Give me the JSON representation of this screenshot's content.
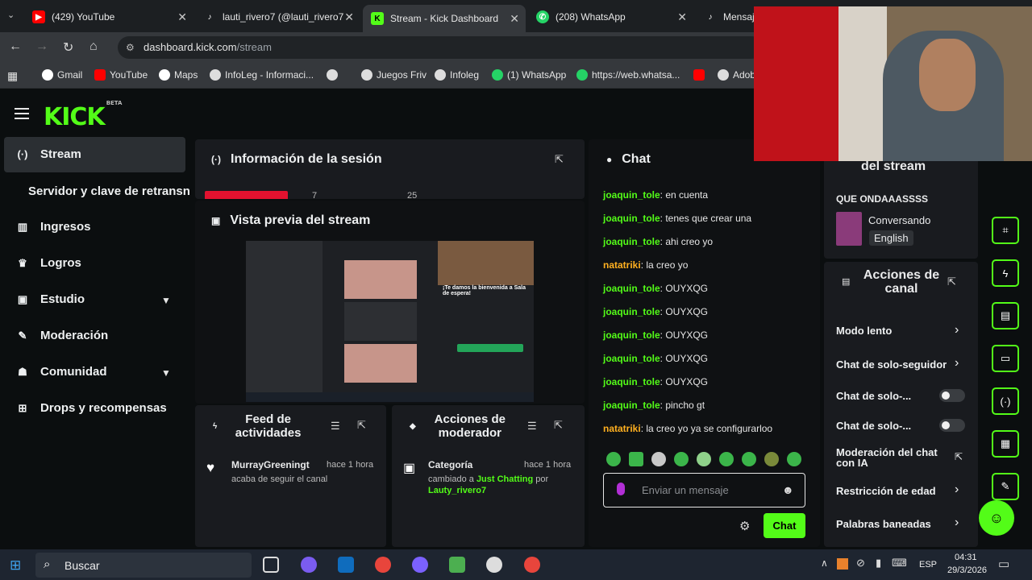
{
  "tabs": [
    {
      "label": "(429) YouTube",
      "icon": "youtube-icon",
      "color": "#ff0000"
    },
    {
      "label": "lauti_rivero7 (@lauti_rivero7",
      "icon": "tiktok-icon",
      "color": "#ffffff"
    },
    {
      "label": "Stream - Kick Dashboard",
      "icon": "kick-icon",
      "color": "#53fc18"
    },
    {
      "label": "(208) WhatsApp",
      "icon": "whatsapp-icon",
      "color": "#25d366"
    },
    {
      "label": "Mensaje",
      "icon": "tiktok-icon",
      "color": "#ffffff"
    }
  ],
  "address": {
    "host": "dashboard.kick.com",
    "path": "/stream"
  },
  "bookmarks": [
    {
      "label": "Gmail",
      "icon": "google-icon"
    },
    {
      "label": "YouTube",
      "icon": "youtube-icon"
    },
    {
      "label": "Maps",
      "icon": "google-icon"
    },
    {
      "label": "InfoLeg - Informaci...",
      "icon": "globe-icon"
    },
    {
      "label": "",
      "icon": "globe-icon"
    },
    {
      "label": "Juegos Friv",
      "icon": "globe-icon"
    },
    {
      "label": "Infoleg",
      "icon": "globe-icon"
    },
    {
      "label": "(1) WhatsApp",
      "icon": "whatsapp-icon"
    },
    {
      "label": "https://web.whatsa...",
      "icon": "whatsapp-icon"
    },
    {
      "label": "",
      "icon": "youtube-icon"
    },
    {
      "label": "Adob",
      "icon": "globe-icon"
    }
  ],
  "brand": {
    "logo": "KICK",
    "beta": "BETA",
    "accent": "#53fc18"
  },
  "sidebar": {
    "items": [
      {
        "label": "Stream"
      },
      {
        "label": "Servidor y clave de retransn"
      },
      {
        "label": "Ingresos"
      },
      {
        "label": "Logros"
      },
      {
        "label": "Estudio"
      },
      {
        "label": "Moderación"
      },
      {
        "label": "Comunidad"
      },
      {
        "label": "Drops y recompensas"
      }
    ]
  },
  "session": {
    "title": "Información de la sesión",
    "n1": "7",
    "n2": "25"
  },
  "preview": {
    "title": "Vista previa del stream",
    "welcome": "¡Te damos la bienvenida a Sala de espera!"
  },
  "feed": {
    "title": "Feed de actividades",
    "user": "MurrayGreeningt",
    "time": "hace 1 hora",
    "text": "acaba de seguir el canal"
  },
  "modactions": {
    "title": "Acciones de moderador",
    "item": "Categoría",
    "time": "hace 1 hora",
    "text1": "cambiado a ",
    "category": "Just Chatting",
    "text2": " por",
    "user": "Lauty_rivero7"
  },
  "chat": {
    "title": "Chat",
    "messages": [
      {
        "user": "joaquin_tole",
        "text": "en cuenta",
        "color": "green"
      },
      {
        "user": "joaquin_tole",
        "text": "tenes que crear una",
        "color": "green"
      },
      {
        "user": "joaquin_tole",
        "text": "ahi creo yo",
        "color": "green"
      },
      {
        "user": "natatriki",
        "text": "la creo yo",
        "color": "orange"
      },
      {
        "user": "joaquin_tole",
        "text": "OUYXQG",
        "color": "green"
      },
      {
        "user": "joaquin_tole",
        "text": "OUYXQG",
        "color": "green"
      },
      {
        "user": "joaquin_tole",
        "text": "OUYXQG",
        "color": "green"
      },
      {
        "user": "joaquin_tole",
        "text": "OUYXQG",
        "color": "green"
      },
      {
        "user": "joaquin_tole",
        "text": "OUYXQG",
        "color": "green"
      },
      {
        "user": "joaquin_tole",
        "text": "pincho gt",
        "color": "green"
      },
      {
        "user": "natatriki",
        "text": "la creo yo ya se configurarloo",
        "color": "orange"
      }
    ],
    "placeholder": "Enviar un mensaje",
    "send": "Chat"
  },
  "streaminfo": {
    "title": "del stream",
    "stream_title": "QUE ONDAAASSSS",
    "category": "Conversando",
    "language": "English"
  },
  "channel_actions": {
    "title": "Acciones de canal",
    "items": [
      {
        "label": "Modo lento",
        "control": "arrow"
      },
      {
        "label": "Chat de solo-seguidor",
        "control": "arrow"
      },
      {
        "label": "Chat de solo-...",
        "control": "toggle"
      },
      {
        "label": "Chat de solo-...",
        "control": "toggle"
      },
      {
        "label": "Moderación del chat con IA",
        "control": "external"
      },
      {
        "label": "Restricción de edad",
        "control": "arrow"
      },
      {
        "label": "Palabras baneadas",
        "control": "arrow"
      }
    ]
  },
  "taskbar": {
    "search": "Buscar",
    "time": "04:31",
    "date": "29/3/2026",
    "lang": "ESP"
  }
}
